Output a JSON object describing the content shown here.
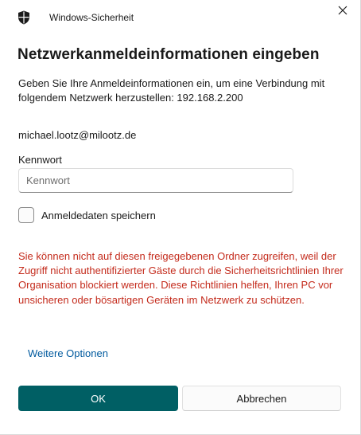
{
  "window": {
    "title": "Windows-Sicherheit",
    "icon": "shield-icon"
  },
  "dialog": {
    "heading": "Netzwerkanmeldeinformationen eingeben",
    "description": "Geben Sie Ihre Anmeldeinformationen ein, um eine Verbindung mit folgendem Netzwerk herzustellen: 192.168.2.200",
    "username": "michael.lootz@milootz.de",
    "password_label": "Kennwort",
    "password_placeholder": "Kennwort",
    "password_value": "",
    "remember_label": "Anmeldedaten speichern",
    "remember_checked": false,
    "error_message": "Sie können nicht auf diesen freigegebenen Ordner zugreifen, weil der Zugriff nicht authentifizierter Gäste durch die Sicherheitsrichtlinien Ihrer Organisation blockiert werden. Diese Richtlinien helfen, Ihren PC vor unsicheren oder bösartigen Geräten im Netzwerk zu schützen.",
    "more_options": "Weitere Optionen"
  },
  "buttons": {
    "ok_label": "OK",
    "cancel_label": "Abbrechen"
  },
  "colors": {
    "accent": "#005f64",
    "error": "#c42b1c",
    "link": "#005a9e"
  }
}
